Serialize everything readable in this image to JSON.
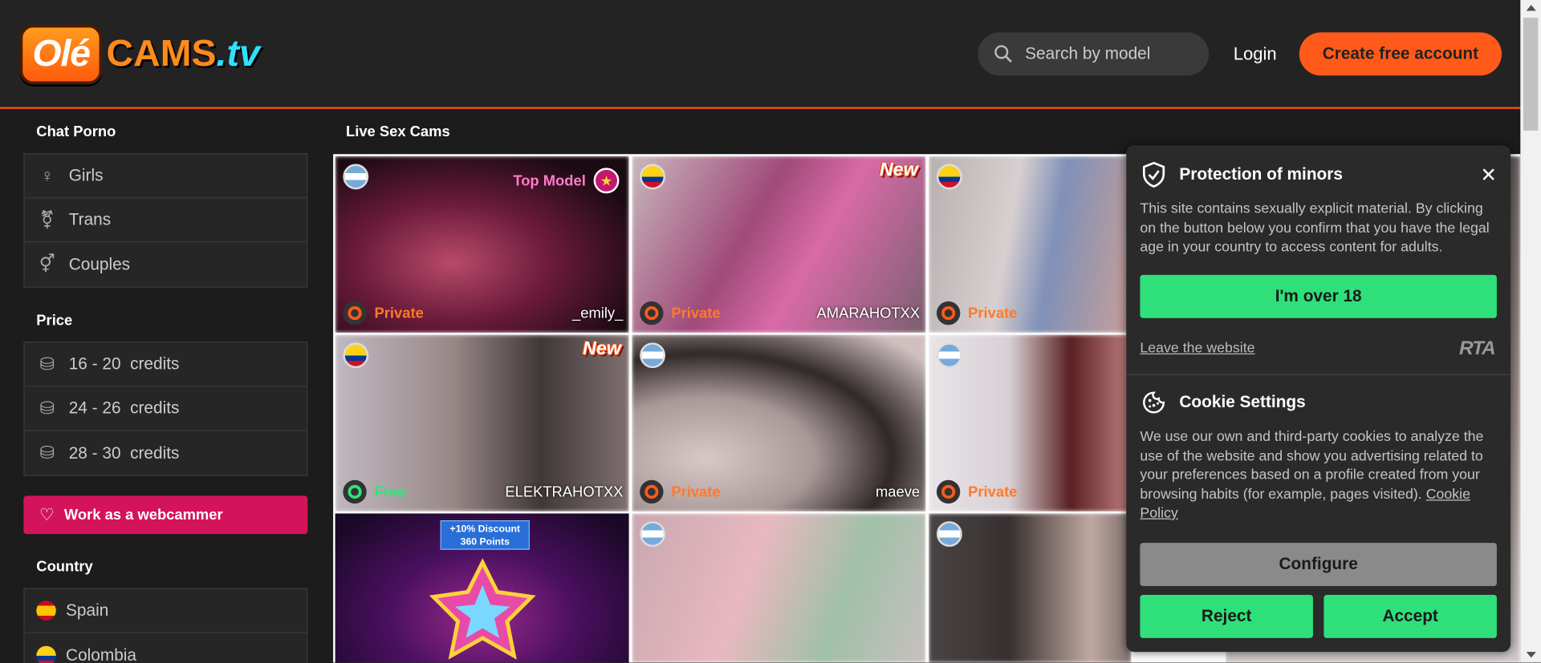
{
  "header": {
    "logo": {
      "part1": "Olé",
      "part2": "CAMS",
      "part3": ".tv"
    },
    "search_placeholder": "Search by model",
    "login_label": "Login",
    "create_account_label": "Create free account",
    "accent_color": "#ff5a1a"
  },
  "sidebar": {
    "chat_title": "Chat Porno",
    "categories": [
      {
        "label": "Girls",
        "icon": "female-icon"
      },
      {
        "label": "Trans",
        "icon": "transgender-icon"
      },
      {
        "label": "Couples",
        "icon": "couple-icon"
      }
    ],
    "price_title": "Price",
    "prices": [
      {
        "label": "16 - 20  credits",
        "icon": "coins-icon"
      },
      {
        "label": "24 - 26  credits",
        "icon": "coins-icon"
      },
      {
        "label": "28 - 30  credits",
        "icon": "coins-icon"
      }
    ],
    "work_label": "Work as a webcammer",
    "country_title": "Country",
    "countries": [
      {
        "label": "Spain",
        "flag": "spain"
      },
      {
        "label": "Colombia",
        "flag": "colombia"
      }
    ]
  },
  "main": {
    "title": "Live Sex Cams",
    "cams": [
      {
        "name": "_emily_",
        "status": "Private",
        "flag": "argentina",
        "badge": "Top Model"
      },
      {
        "name": "AMARAHOTXX",
        "status": "Private",
        "flag": "colombia",
        "badge": "New"
      },
      {
        "name": "",
        "status": "Private",
        "flag": "colombia",
        "badge": ""
      },
      {
        "name": "ELEKTRAHOTXX",
        "status": "Free",
        "flag": "colombia",
        "badge": "New"
      },
      {
        "name": "maeve",
        "status": "Private",
        "flag": "argentina",
        "badge": ""
      },
      {
        "name": "",
        "status": "Private",
        "flag": "argentina",
        "badge": ""
      },
      {
        "name": "",
        "status": "",
        "flag": "",
        "badge": "",
        "promo_title": "+10% Discount",
        "promo_sub": "360 Points"
      },
      {
        "name": "",
        "status": "",
        "flag": "argentina",
        "badge": ""
      },
      {
        "name": "",
        "status": "",
        "flag": "argentina",
        "badge": ""
      }
    ]
  },
  "modal": {
    "minors_title": "Protection of minors",
    "minors_text": "This site contains sexually explicit material. By clicking on the button below you confirm that you have the legal age in your country to access content for adults.",
    "over18_label": "I'm over 18",
    "leave_label": "Leave the website",
    "rta_label": "RTA",
    "close_label": "✕",
    "cookie_title": "Cookie Settings",
    "cookie_text": "We use our own and third-party cookies to analyze the use of the website and show you advertising related to your preferences based on a profile created from your browsing habits (for example, pages visited).",
    "cookie_link": "Cookie Policy",
    "configure_label": "Configure",
    "reject_label": "Reject",
    "accept_label": "Accept"
  }
}
